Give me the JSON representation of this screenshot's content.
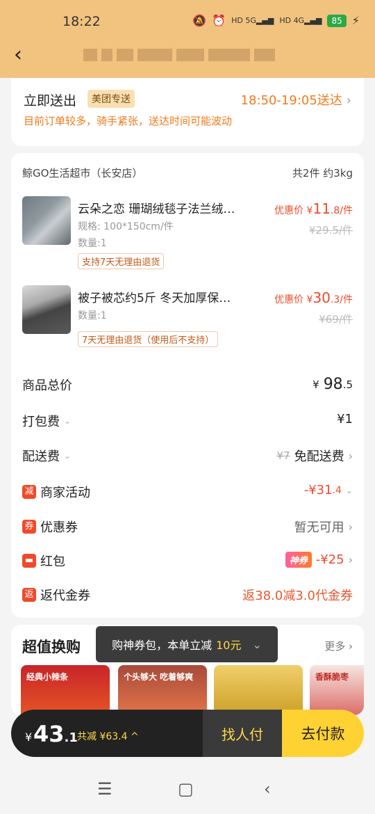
{
  "status": {
    "time": "18:22",
    "battery": "85",
    "net1": "5G",
    "net2": "4G"
  },
  "delivery": {
    "send_now": "立即送出",
    "badge": "美团专送",
    "time_range": "18:50-19:05送达",
    "notice": "目前订单较多，骑手紧张，送达时间可能波动"
  },
  "store": {
    "name": "鲸GO生活超市（长安店）",
    "count": "共2件 约3kg"
  },
  "products": [
    {
      "title": "云朵之恋 珊瑚绒毯子法兰绒…",
      "spec": "规格: 100*150cm/件",
      "qty": "数量:1",
      "tag": "支持7天无理由退货",
      "price_prefix": "优惠价 ¥",
      "price_int": "11",
      "price_dec": ".8/件",
      "old_price": "¥29.5/件"
    },
    {
      "title": "被子被芯约5斤 冬天加厚保…",
      "qty": "数量:1",
      "tag": "7天无理由退货（使用后不支持）",
      "price_prefix": "优惠价 ¥",
      "price_int": "30",
      "price_dec": ".3/件",
      "old_price": "¥69/件"
    }
  ],
  "summary": {
    "goods_total_label": "商品总价",
    "goods_total_yen": "¥",
    "goods_total_int": "98",
    "goods_total_dec": ".5",
    "packing_label": "打包费",
    "packing_value": "¥1",
    "delivery_label": "配送费",
    "delivery_old": "¥7",
    "delivery_value": "免配送费",
    "merchant_label": "商家活动",
    "merchant_icon": "减",
    "merchant_value": "-¥31",
    "merchant_dec": ".4",
    "coupon_label": "优惠券",
    "coupon_icon": "券",
    "coupon_value": "暂无可用",
    "redpacket_label": "红包",
    "redpacket_badge": "神券",
    "redpacket_value": "-¥25",
    "cashback_label": "返代金券",
    "cashback_icon": "返",
    "cashback_value": "返38.0减3.0代金券"
  },
  "deals": {
    "title": "超值换购",
    "more": "更多",
    "tiles": [
      "经典小辣条",
      "个头够大 吃着够爽",
      "",
      "香酥脆枣"
    ]
  },
  "toast": {
    "text": "购神券包，本单立减",
    "highlight": "10元"
  },
  "paybar": {
    "yen": "¥",
    "amount": "43",
    "amount_dec": ".1",
    "saved": "共减 ¥63.4",
    "friend_pay": "找人付",
    "pay": "去付款"
  },
  "colors": {
    "header": "#f2c37f",
    "accent": "#f27a1a",
    "price_red": "#f04a2a",
    "pay_yellow": "#ffd233"
  }
}
